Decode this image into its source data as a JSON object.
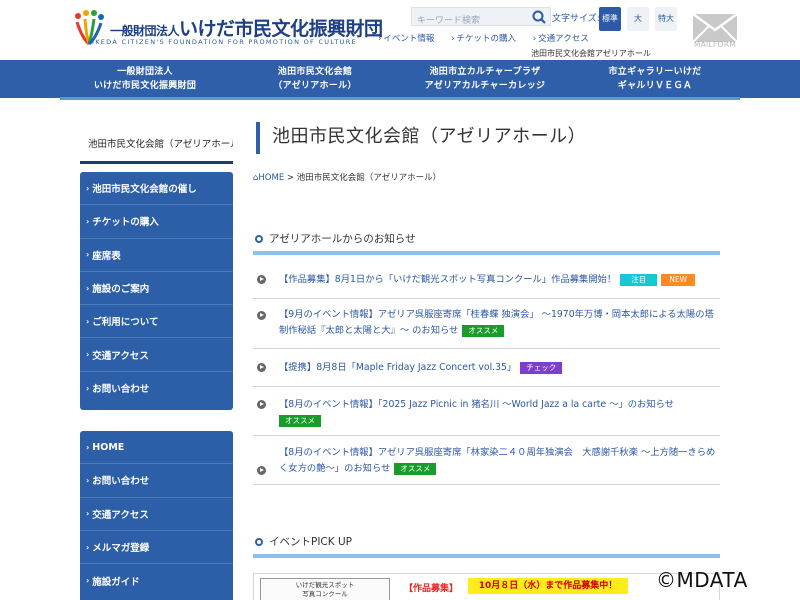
{
  "header": {
    "logo_small": "一般財団法人",
    "logo_main": "いけだ市民文化振興財団",
    "logo_sub": "IKEDA CITIZEN'S FOUNDATION FOR PROMOTION OF CULTURE",
    "search_placeholder": "キーワード検索",
    "fontsize_label": "文字サイズ:",
    "fontsize_standard": "標準",
    "fontsize_medium": "大",
    "fontsize_large": "特大",
    "util_links": [
      "イベント情報",
      "チケットの購入",
      "交通アクセス"
    ],
    "azalea_link": "池田市民文化会館アゼリアホール",
    "mailform_label": "MAILFORM"
  },
  "gnav": [
    {
      "line1": "一般財団法人",
      "line2": "いけだ市民文化振興財団"
    },
    {
      "line1": "池田市民文化会館",
      "line2": "（アゼリアホール）"
    },
    {
      "line1": "池田市立カルチャープラザ",
      "line2": "アゼリアカルチャーカレッジ"
    },
    {
      "line1": "市立ギャラリーいけだ",
      "line2": "ギャルリＶＥＧＡ"
    }
  ],
  "sidebar": {
    "title": "池田市民文化会館（アゼリアホール）",
    "menu1": [
      "池田市民文化会館の催し",
      "チケットの購入",
      "座席表",
      "施設のご案内",
      "ご利用について",
      "交通アクセス",
      "お問い合わせ"
    ],
    "menu2": [
      "HOME",
      "お問い合わせ",
      "交通アクセス",
      "メルマガ登録",
      "施設ガイド"
    ]
  },
  "main": {
    "page_title": "池田市民文化会館（アゼリアホール）",
    "breadcrumb_home": "HOME",
    "breadcrumb_sep": ">",
    "breadcrumb_current": "池田市民文化会館（アゼリアホール）",
    "news_title": "アゼリアホールからのお知らせ",
    "news": [
      {
        "text": "【作品募集】8月1日から「いけだ観光スポット写真コンクール」作品募集開始！",
        "badges": [
          "注目",
          "NEW"
        ]
      },
      {
        "text": "【9月のイベント情報】アゼリア呉服座寄席「桂春蝶 独演会」 ～1970年万博・岡本太郎による太陽の塔制作秘話『太郎と太陽と大』～ のお知らせ",
        "badges": [
          "オススメ"
        ]
      },
      {
        "text": "【提携】8月8日「Maple Friday Jazz Concert vol.35」",
        "badges": [
          "チェック"
        ]
      },
      {
        "text": "【8月のイベント情報】「2025 Jazz Picnic in 猪名川 ～World Jazz a la carte ～」のお知らせ",
        "badges": [
          "オススメ"
        ]
      },
      {
        "text": "【8月のイベント情報】アゼリア呉服座寄席「林家染二４０周年独演会　大感謝千秋楽 ～上方随一きらめく女方の艶～」のお知らせ",
        "badges": [
          "オススメ"
        ]
      }
    ],
    "pickup_title": "イベントPICK UP",
    "pickup_thumb_line1": "いけだ観光スポット",
    "pickup_thumb_line2": "写真コンクール",
    "pickup_tag": "【作品募集】",
    "pickup_banner": "10月８日（水）まで作品募集中！"
  },
  "watermark": "©MDATA",
  "colors": {
    "brand_blue": "#2f5fa8",
    "link_blue": "#2b57a8",
    "accent_light": "#8ec0e8"
  }
}
